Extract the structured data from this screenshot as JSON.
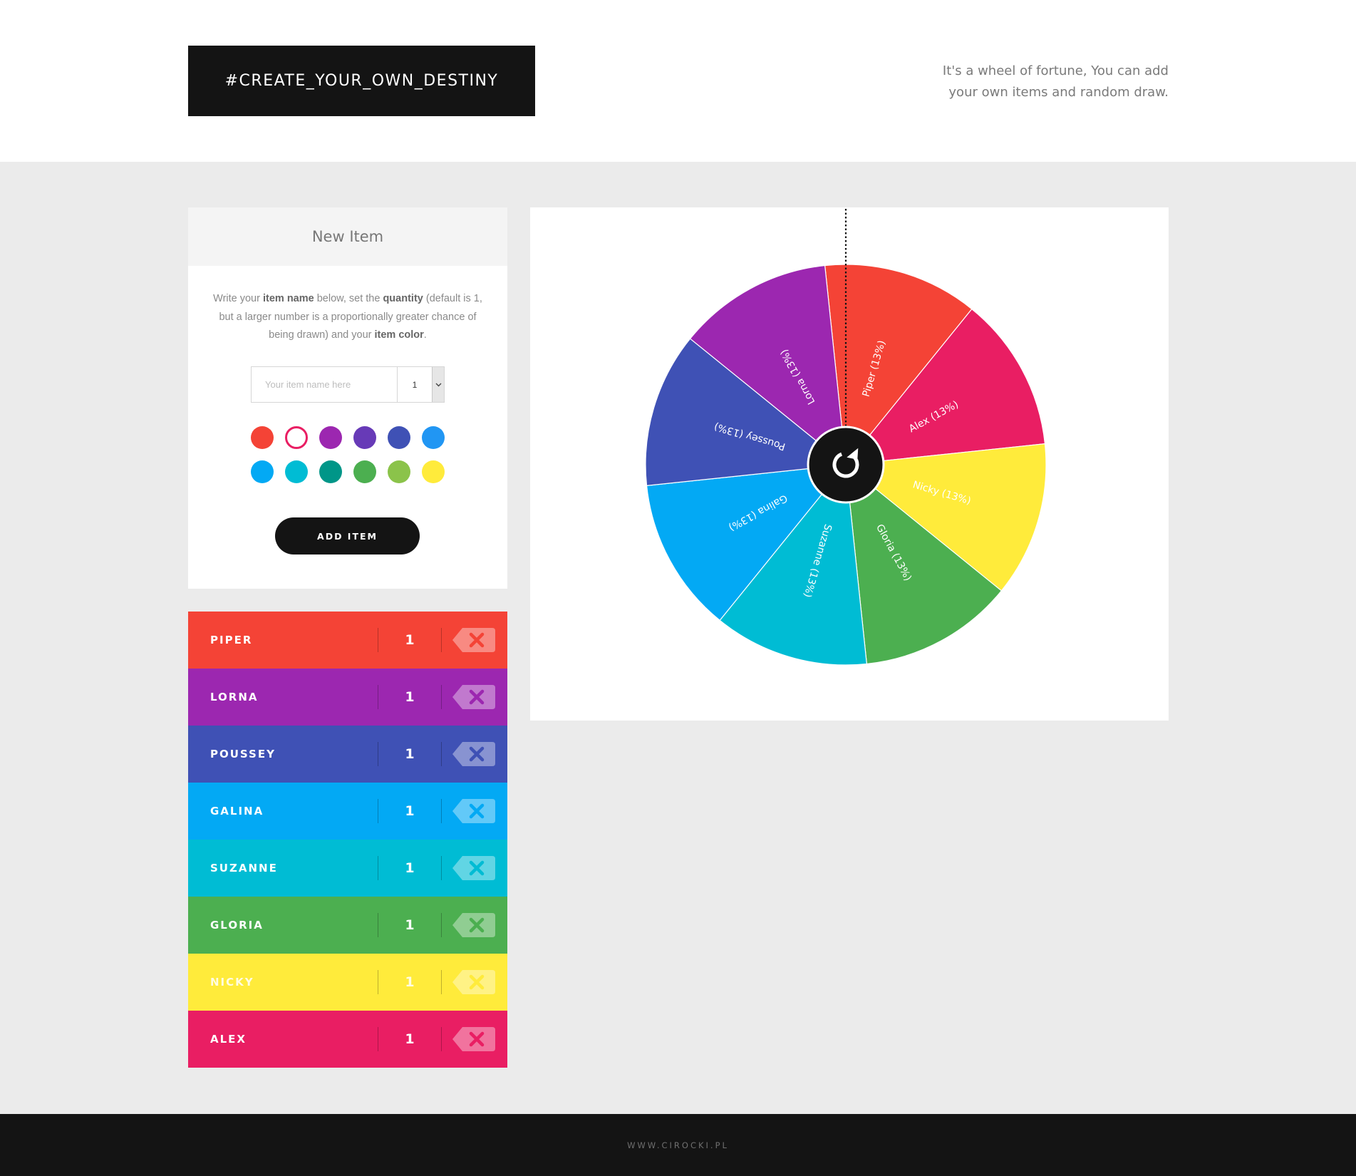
{
  "header": {
    "title": "#CREATE_YOUR_OWN_DESTINY",
    "tagline_line1": "It's a wheel of fortune, You can add",
    "tagline_line2": "your own items and random draw."
  },
  "new_item": {
    "heading": "New Item",
    "desc": {
      "t1": "Write your ",
      "b1": "item name",
      "t2": " below, set the ",
      "b2": "quantity",
      "t3": " (default is 1, but a larger number is a proportionally greater chance of being drawn) and your ",
      "b3": "item color",
      "t4": "."
    },
    "name_placeholder": "Your item name here",
    "quantity_value": "1",
    "spinner_icon": "chevron-down-icon",
    "swatches": [
      {
        "color": "#f44336",
        "selected": false
      },
      {
        "color": "#e91e63",
        "selected": true
      },
      {
        "color": "#9c27b0",
        "selected": false
      },
      {
        "color": "#673ab7",
        "selected": false
      },
      {
        "color": "#3f51b5",
        "selected": false
      },
      {
        "color": "#2196f3",
        "selected": false
      },
      {
        "color": "#03a9f4",
        "selected": false
      },
      {
        "color": "#00bcd4",
        "selected": false
      },
      {
        "color": "#009688",
        "selected": false
      },
      {
        "color": "#4caf50",
        "selected": false
      },
      {
        "color": "#8bc34a",
        "selected": false
      },
      {
        "color": "#ffeb3b",
        "selected": false
      }
    ],
    "add_button": "ADD ITEM"
  },
  "items": [
    {
      "name": "PIPER",
      "qty": "1",
      "color": "#f44336"
    },
    {
      "name": "LORNA",
      "qty": "1",
      "color": "#9c27b0"
    },
    {
      "name": "POUSSEY",
      "qty": "1",
      "color": "#3f51b5"
    },
    {
      "name": "GALINA",
      "qty": "1",
      "color": "#03a9f4"
    },
    {
      "name": "SUZANNE",
      "qty": "1",
      "color": "#00bcd4"
    },
    {
      "name": "GLORIA",
      "qty": "1",
      "color": "#4caf50"
    },
    {
      "name": "NICKY",
      "qty": "1",
      "color": "#ffeb3b"
    },
    {
      "name": "ALEX",
      "qty": "1",
      "color": "#e91e63"
    }
  ],
  "delete_icon": "backspace-x-icon",
  "wheel": {
    "pointer": "dotted-pointer-line",
    "spin_icon": "refresh-icon",
    "center_color": "#141414",
    "segments": [
      {
        "label": "Piper (13%)",
        "color": "#f44336"
      },
      {
        "label": "Alex (13%)",
        "color": "#e91e63"
      },
      {
        "label": "Nicky (13%)",
        "color": "#ffeb3b"
      },
      {
        "label": "Gloria (13%)",
        "color": "#4caf50"
      },
      {
        "label": "Suzanne (13%)",
        "color": "#00bcd4"
      },
      {
        "label": "Galina (13%)",
        "color": "#03a9f4"
      },
      {
        "label": "Poussey (13%)",
        "color": "#3f51b5"
      },
      {
        "label": "Lorna (13%)",
        "color": "#9c27b0"
      }
    ]
  },
  "footer": "WWW.CIROCKI.PL"
}
